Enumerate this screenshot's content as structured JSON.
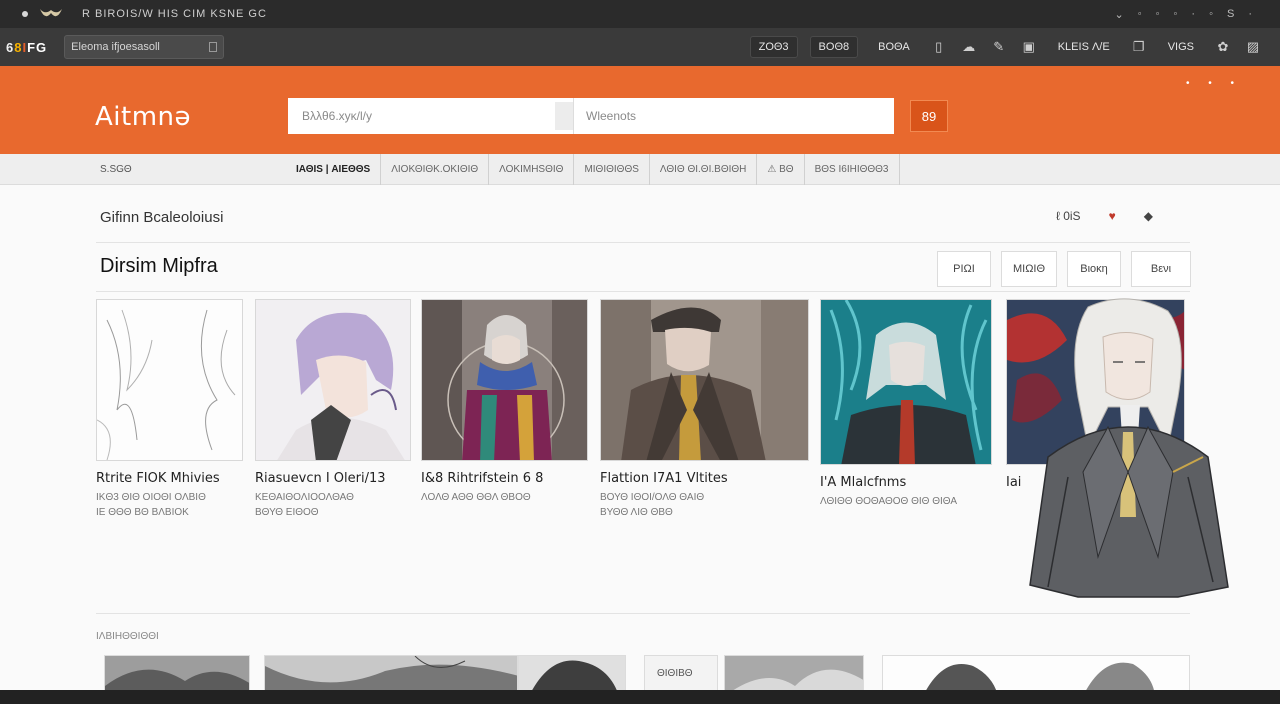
{
  "window": {
    "title": "R BIROIS/W HIS CIM  KSNE GC",
    "controls": [
      "⌄",
      "◦",
      "◦",
      "◦",
      "·",
      "◦",
      "S",
      "·"
    ]
  },
  "toolbar": {
    "brand_letters": [
      "6",
      "8",
      "I",
      "F",
      "G"
    ],
    "url": "Eleoma  ifjoesasoll",
    "items": [
      "ΖΟΘ3",
      "ΒΟΘ8",
      "ΒΟΘΑ"
    ],
    "right_label": "KLEIS Λ/Ε",
    "vs_label": "VIGS"
  },
  "header": {
    "site_title": "Aitmnə",
    "search_placeholder": "Bλλθ6.xyκ/l/y",
    "search_placeholder_2": "Wleenots",
    "go_label": "89",
    "dots": "• • •"
  },
  "subnav": {
    "left_label": "S.SGΘ",
    "tabs": [
      {
        "label": "ΙΑΘΙS | ΑΙΕΘΘS"
      },
      {
        "label": "ΛΙΟΚΘΙΘΚ.ΟΚΙΘΙΘ"
      },
      {
        "label": "ΛΟΚΙΜΗSΘΙΘ"
      },
      {
        "label": "ΜΙΘΙΘΙΘΘS"
      },
      {
        "label": "ΛΘΙΘ ΘΙ.ΘΙ.ΒΘΙΘΗ"
      },
      {
        "label": "⚠ ΒΘ"
      },
      {
        "label": "ΒΘS Ι6ΙΗΙΘΘΘ3"
      }
    ]
  },
  "main": {
    "section_title": "Gifinn Bcaleoloiusi",
    "actions": [
      "ℓ 0iS",
      "♥",
      "◆"
    ],
    "page_title": "Dirsim Mipfra",
    "filters": [
      "ΡΙΩΙ",
      "ΜΙΩΙΘ",
      "Βιοκη",
      "Βενι"
    ],
    "cards": [
      {
        "name": "Rtrite FIOK Mhivies",
        "meta": [
          "IKΘ3 ΘΙΘ ΟΙΟΘΙ ΟΛΒΙΘ",
          "IΕ ΘΘΘ ΒΘ ΒΛΒΙΟΚ"
        ]
      },
      {
        "name": "Riasuevcn I Oleri/13",
        "meta": [
          "ΚΕΘΑΙΘΟΛΙΟΟΛΘΑΘ",
          "ΒΘΥΘ ΕΙΘΟΘ"
        ]
      },
      {
        "name": "I&8 Rihtrifstein 6 8",
        "meta": [
          "ΛΟΛΘ ΑΘΘ ΘΘΛ ΘΒΟΘ"
        ]
      },
      {
        "name": "Flattion I7A1 Vltites",
        "meta": [
          "ΒΟΥΘ ΙΘΟΙ/ΟΛΘ ΘΑΙΘ",
          "ΒΥΘΘ ΛΙΘ ΘΒΘ"
        ]
      },
      {
        "name": "I'A Mlalcfnms",
        "meta": [
          "ΛΘΙΘΘ ΘΟΘΑΘΟΘ ΘΙΘ ΘΙΘΑ"
        ]
      },
      {
        "name": "Iai",
        "meta": []
      }
    ],
    "related_label": "IΛΒΙΗΘΘΙΘΘΙ",
    "thumb_label": "ΘΙΘΙΒΘ"
  },
  "colors": {
    "accent": "#e8692e",
    "accent_dark": "#d9541a",
    "chrome": "#3a3a3a"
  }
}
